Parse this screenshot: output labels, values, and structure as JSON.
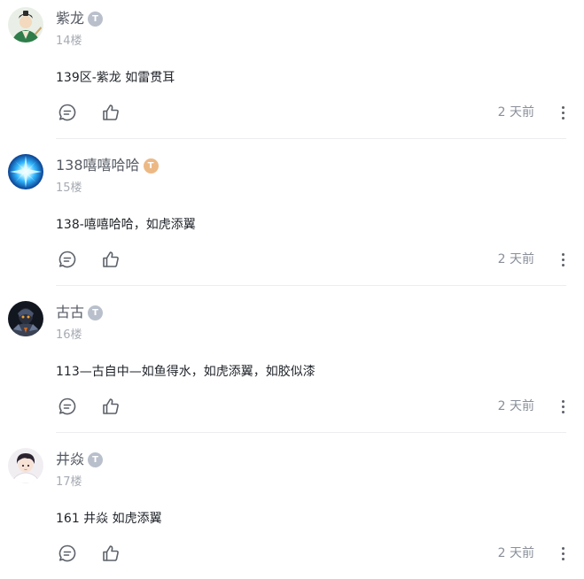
{
  "comments": [
    {
      "username": "紫龙",
      "badge": "T",
      "badge_color": "grey",
      "avatar": "avatar-ancient-scholar",
      "floor": "14楼",
      "content": "139区-紫龙  如雷贯耳",
      "time": "2 天前",
      "icons": {
        "reply": "comment-icon",
        "like": "thumbs-up-icon",
        "more": "more-vertical-icon"
      }
    },
    {
      "username": "138嘻嘻哈哈",
      "badge": "T",
      "badge_color": "gold",
      "avatar": "avatar-blue-light-burst",
      "floor": "15楼",
      "content": "138-嘻嘻哈哈，如虎添翼",
      "time": "2 天前",
      "icons": {
        "reply": "comment-icon",
        "like": "thumbs-up-icon",
        "more": "more-vertical-icon"
      }
    },
    {
      "username": "古古",
      "badge": "T",
      "badge_color": "grey",
      "avatar": "avatar-dark-armored-warrior",
      "floor": "16楼",
      "content": "113—古自中—如鱼得水，如虎添翼，如胶似漆",
      "time": "2 天前",
      "icons": {
        "reply": "comment-icon",
        "like": "thumbs-up-icon",
        "more": "more-vertical-icon"
      }
    },
    {
      "username": "井焱",
      "badge": "T",
      "badge_color": "grey",
      "avatar": "avatar-anime-boy",
      "floor": "17楼",
      "content": "161  井焱  如虎添翼",
      "time": "2 天前",
      "icons": {
        "reply": "comment-icon",
        "like": "thumbs-up-icon",
        "more": "more-vertical-icon"
      }
    }
  ]
}
